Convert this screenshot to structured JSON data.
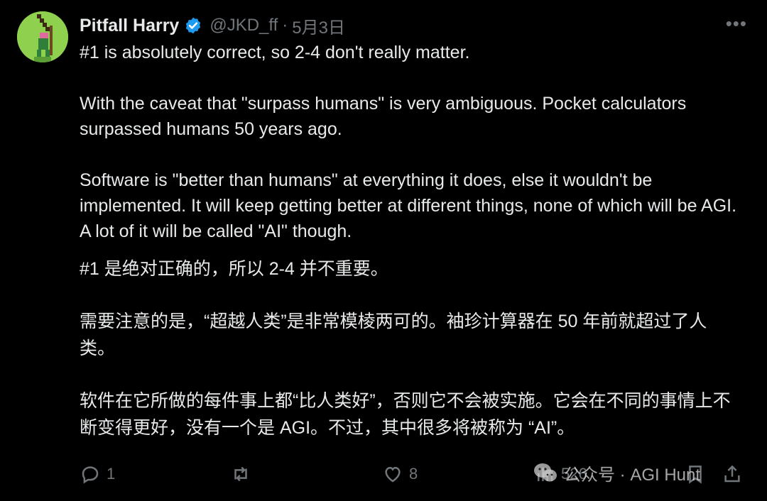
{
  "tweet": {
    "author_name": "Pitfall Harry",
    "handle": "@JKD_ff",
    "separator": "·",
    "date": "5月3日",
    "more_label": "•••",
    "paragraphs_en": [
      "#1 is absolutely correct, so 2-4 don't really matter.",
      "With the caveat that \"surpass humans\" is very ambiguous. Pocket calculators surpassed humans 50 years ago.",
      "Software is \"better than humans\" at everything it does, else it wouldn't be implemented. It will keep getting better at different things, none of which will be AGI. A lot of it will be called \"AI\" though."
    ],
    "paragraphs_zh": [
      "#1 是绝对正确的，所以 2-4 并不重要。",
      "需要注意的是，“超越人类”是非常模棱两可的。袖珍计算器在 50 年前就超过了人类。",
      "软件在它所做的每件事上都“比人类好”，否则它不会被实施。它会在不同的事情上不断变得更好，没有一个是 AGI。不过，其中很多将被称为 “AI”。"
    ]
  },
  "actions": {
    "reply_count": "1",
    "retweet_count": "",
    "like_count": "8",
    "views_count": "526"
  },
  "watermark": {
    "text": "公众号 · AGI Hunt"
  },
  "icons": {
    "verified": "verified-badge-icon",
    "reply": "reply-icon",
    "retweet": "retweet-icon",
    "like": "heart-icon",
    "views": "views-icon",
    "bookmark": "bookmark-icon",
    "share": "share-icon"
  },
  "colors": {
    "background": "#000000",
    "text": "#e7e9ea",
    "muted": "#71767b",
    "verified": "#1d9bf0"
  }
}
